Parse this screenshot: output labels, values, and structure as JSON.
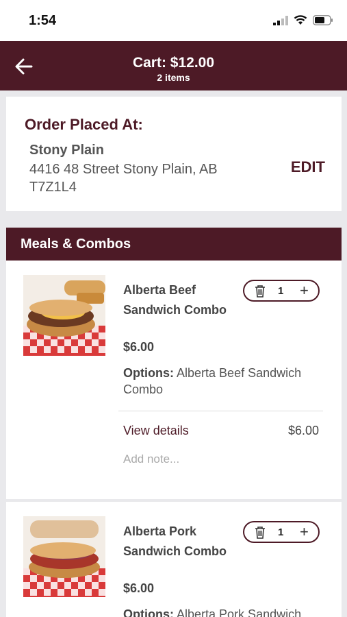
{
  "status_bar": {
    "time": "1:54"
  },
  "header": {
    "title": "Cart: $12.00",
    "subtitle": "2 items"
  },
  "order": {
    "heading": "Order Placed At:",
    "store_name": "Stony Plain",
    "address": "4416 48 Street Stony Plain, AB T7Z1L4",
    "edit_label": "EDIT"
  },
  "section": {
    "title": "Meals & Combos"
  },
  "items": [
    {
      "name": "Alberta Beef Sandwich Combo",
      "quantity": "1",
      "price": "$6.00",
      "options_label": "Options:",
      "options_value": "Alberta Beef Sandwich Combo",
      "view_details": "View details",
      "detail_price": "$6.00",
      "note_placeholder": "Add note..."
    },
    {
      "name": "Alberta Pork Sandwich Combo",
      "quantity": "1",
      "price": "$6.00",
      "options_label": "Options:",
      "options_value": "Alberta Pork Sandwich"
    }
  ],
  "colors": {
    "brand": "#4d1a26",
    "background": "#e9e9ec"
  }
}
